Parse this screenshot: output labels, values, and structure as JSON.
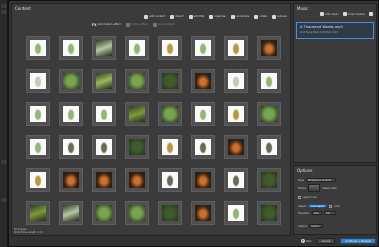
{
  "content": {
    "title": "Content",
    "toolbar": [
      {
        "label": "add content",
        "icon": "add-content-icon"
      },
      {
        "label": "import",
        "icon": "import-icon"
      },
      {
        "label": "add title",
        "icon": "add-title-icon"
      },
      {
        "label": "organize",
        "icon": "organize-icon"
      },
      {
        "label": "randomize",
        "icon": "randomize-icon"
      },
      {
        "label": "rotate",
        "icon": "rotate-icon"
      },
      {
        "label": "remove",
        "icon": "remove-icon"
      }
    ],
    "toolbar2": [
      {
        "label": "add motion effect",
        "icon": "fx-icon",
        "symbol": "FX"
      },
      {
        "label": "motion effect",
        "icon": "motion-effect-icon"
      },
      {
        "label": "view content",
        "icon": "view-content-icon"
      }
    ],
    "footer_count": "50 Images",
    "footer_length": "Slide Show Length: 4:11"
  },
  "music": {
    "title": "Music",
    "toolbar": [
      {
        "label": "add music",
        "icon": "add-music-icon"
      },
      {
        "label": "music folders",
        "icon": "music-folders-icon"
      },
      {
        "label": "",
        "icon": "settings-icon"
      }
    ],
    "track": {
      "title": "A Thousand Words.mp3",
      "meta": "4:13 Song Start: 0:00 End: 4:13"
    }
  },
  "options": {
    "title": "Options",
    "fields": {
      "style_label": "Style",
      "style_value": "Background Gradient",
      "theme_label": "Theme",
      "fixed_label": "Classic fade",
      "aspect_label": "Aspect",
      "aspect_value": "Auto Aspect",
      "transition_label": "Transition",
      "transition_value": "Auto",
      "speed_label": "Speed",
      "speed_value": "3.0s",
      "caption_label": "Caption",
      "caption_button": "Custom",
      "chk1": "Apply to all",
      "chk2": "Auto"
    }
  },
  "footer": {
    "help_label": "Help",
    "cancel_label": "Cancel",
    "continue_label": "Continue > Preview"
  },
  "thumbs": [
    {
      "kind": "chrysalis-green"
    },
    {
      "kind": "chrysalis-green"
    },
    {
      "kind": "caterpillar-white"
    },
    {
      "kind": "chrysalis-green"
    },
    {
      "kind": "chrysalis-gold"
    },
    {
      "kind": "chrysalis-green"
    },
    {
      "kind": "chrysalis-gold"
    },
    {
      "kind": "butterfly"
    },
    {
      "kind": "chrysalis-white"
    },
    {
      "kind": "leaf-green"
    },
    {
      "kind": "caterpillar-green"
    },
    {
      "kind": "leaf-green"
    },
    {
      "kind": "leaf-dark"
    },
    {
      "kind": "butterfly"
    },
    {
      "kind": "chrysalis-white"
    },
    {
      "kind": "chrysalis-green"
    },
    {
      "kind": "chrysalis-green"
    },
    {
      "kind": "chrysalis-green"
    },
    {
      "kind": "chrysalis-green"
    },
    {
      "kind": "caterpillar"
    },
    {
      "kind": "leaf-green"
    },
    {
      "kind": "chrysalis-green"
    },
    {
      "kind": "chrysalis-gold"
    },
    {
      "kind": "leaf-green"
    },
    {
      "kind": "chrysalis-green"
    },
    {
      "kind": "chrysalis-dark"
    },
    {
      "kind": "chrysalis-dark"
    },
    {
      "kind": "leaf-dark"
    },
    {
      "kind": "chrysalis-gold"
    },
    {
      "kind": "chrysalis-dark"
    },
    {
      "kind": "butterfly"
    },
    {
      "kind": "chrysalis-dark"
    },
    {
      "kind": "chrysalis-gold"
    },
    {
      "kind": "butterfly"
    },
    {
      "kind": "butterfly"
    },
    {
      "kind": "butterfly"
    },
    {
      "kind": "chrysalis-dark"
    },
    {
      "kind": "butterfly"
    },
    {
      "kind": "chrysalis-dark"
    },
    {
      "kind": "leaf-dark"
    },
    {
      "kind": "caterpillar"
    },
    {
      "kind": "caterpillar-white"
    },
    {
      "kind": "leaf-green"
    },
    {
      "kind": "leaf-green"
    },
    {
      "kind": "leaf-dark"
    },
    {
      "kind": "butterfly"
    },
    {
      "kind": "chrysalis-green"
    },
    {
      "kind": "leaf-dark"
    }
  ],
  "colors": {
    "chrysalis-green": "#8fb872",
    "chrysalis-gold": "#b89a3e",
    "chrysalis-white": "#c9c9b6",
    "chrysalis-dark": "#6b6a58",
    "butterfly": "#d0702a",
    "caterpillar": "#7c9a3c",
    "caterpillar-white": "#b8c7a0",
    "caterpillar-green": "#9ab85a",
    "leaf-green": "#79a44f",
    "leaf-dark": "#3f5a2b",
    "accent": "#3d7fc1"
  }
}
